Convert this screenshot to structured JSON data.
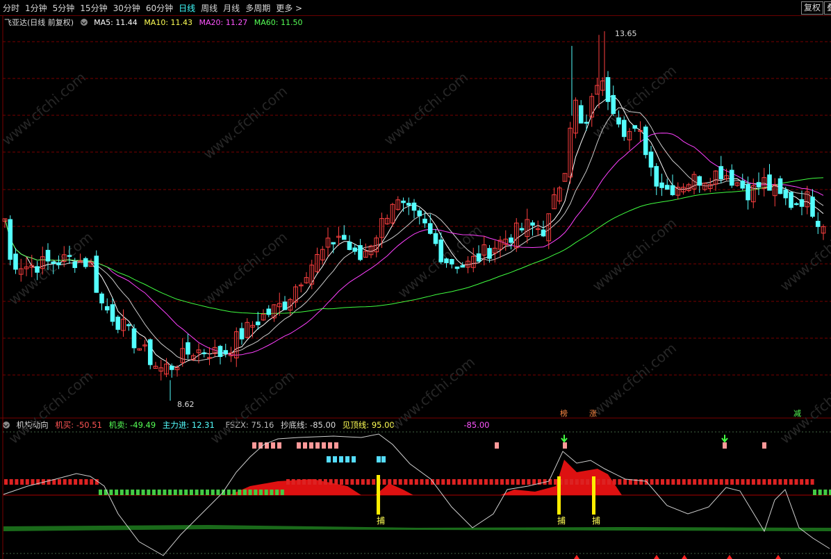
{
  "toolbar": {
    "tabs": [
      "分时",
      "1分钟",
      "5分钟",
      "15分钟",
      "30分钟",
      "60分钟",
      "日线",
      "周线",
      "月线",
      "多周期",
      "更多 >"
    ],
    "active_tab": "日线",
    "right_buttons": [
      "复权",
      "叠"
    ]
  },
  "main_chart": {
    "title": "飞亚达(日线 前复权)",
    "ma5": "MA5: 11.44",
    "ma10": "MA10: 11.43",
    "ma20": "MA20: 11.27",
    "ma60": "MA60: 11.50",
    "high_label": "13.65",
    "low_label": "8.62",
    "markers": [
      "榜",
      "涨",
      "减"
    ],
    "watermark": "www.cfchi.com"
  },
  "indicator": {
    "title": "机构动向",
    "jimai": "机买: -50.51",
    "jimai2": "机卖: -49.49",
    "zhulijin": "主力进: 12.31",
    "fszx": "FSZX: 75.16",
    "chaodi": "抄底线: -85.00",
    "jianding": "见顶线: 95.00",
    "extra": "-85.00",
    "signal_text": [
      "捕",
      "捕",
      "捕"
    ]
  },
  "colors": {
    "up": "#ff4040",
    "down": "#54ffff",
    "ma5": "#ffffff",
    "ma10": "#ffff00",
    "ma20": "#ff40ff",
    "ma60": "#40ff40",
    "grid": "#7a0000"
  }
}
